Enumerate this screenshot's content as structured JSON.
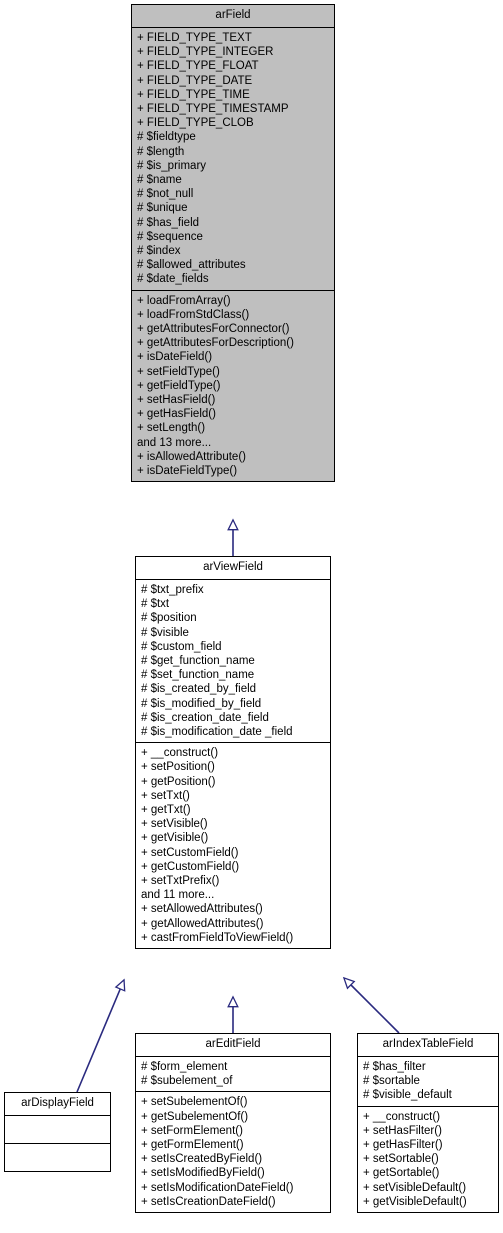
{
  "diagram": {
    "type": "uml-class-inheritance",
    "background_color": "#ffffff",
    "edge_color": "#2a2a7f",
    "base_fill_color": "#bfbfbf",
    "border_color": "#000000"
  },
  "classes": {
    "arField": {
      "name": "arField",
      "attributes": [
        "+ FIELD_TYPE_TEXT",
        "+ FIELD_TYPE_INTEGER",
        "+ FIELD_TYPE_FLOAT",
        "+ FIELD_TYPE_DATE",
        "+ FIELD_TYPE_TIME",
        "+ FIELD_TYPE_TIMESTAMP",
        "+ FIELD_TYPE_CLOB",
        "# $fieldtype",
        "# $length",
        "# $is_primary",
        "# $name",
        "# $not_null",
        "# $unique",
        "# $has_field",
        "# $sequence",
        "# $index",
        "# $allowed_attributes",
        "# $date_fields"
      ],
      "methods": [
        "+ loadFromArray()",
        "+ loadFromStdClass()",
        "+ getAttributesForConnector()",
        "+ getAttributesForDescription()",
        "+ isDateField()",
        "+ setFieldType()",
        "+ getFieldType()",
        "+ setHasField()",
        "+ getHasField()",
        "+ setLength()",
        "and 13 more...",
        "+ isAllowedAttribute()",
        "+ isDateFieldType()"
      ]
    },
    "arViewField": {
      "name": "arViewField",
      "attributes": [
        "# $txt_prefix",
        "# $txt",
        "# $position",
        "# $visible",
        "# $custom_field",
        "# $get_function_name",
        "# $set_function_name",
        "# $is_created_by_field",
        "# $is_modified_by_field",
        "# $is_creation_date_field",
        "# $is_modification_date _field"
      ],
      "methods": [
        "+ __construct()",
        "+ setPosition()",
        "+ getPosition()",
        "+ setTxt()",
        "+ getTxt()",
        "+ setVisible()",
        "+ getVisible()",
        "+ setCustomField()",
        "+ getCustomField()",
        "+ setTxtPrefix()",
        "and 11 more...",
        "+ setAllowedAttributes()",
        "+ getAllowedAttributes()",
        "+ castFromFieldToViewField()"
      ]
    },
    "arEditField": {
      "name": "arEditField",
      "attributes": [
        "# $form_element",
        "# $subelement_of"
      ],
      "methods": [
        "+ setSubelementOf()",
        "+ getSubelementOf()",
        "+ setFormElement()",
        "+ getFormElement()",
        "+ setIsCreatedByField()",
        "+ setIsModifiedByField()",
        "+ setIsModificationDateField()",
        "+ setIsCreationDateField()"
      ]
    },
    "arIndexTableField": {
      "name": "arIndexTableField",
      "attributes": [
        "# $has_filter",
        "# $sortable",
        "# $visible_default"
      ],
      "methods": [
        "+ __construct()",
        "+ setHasFilter()",
        "+ getHasFilter()",
        "+ setSortable()",
        "+ getSortable()",
        "+ setVisibleDefault()",
        "+ getVisibleDefault()"
      ]
    },
    "arDisplayField": {
      "name": "arDisplayField",
      "attributes": [],
      "methods": []
    }
  },
  "relationships": [
    {
      "from": "arViewField",
      "to": "arField",
      "kind": "generalization"
    },
    {
      "from": "arEditField",
      "to": "arViewField",
      "kind": "generalization"
    },
    {
      "from": "arIndexTableField",
      "to": "arViewField",
      "kind": "generalization"
    },
    {
      "from": "arDisplayField",
      "to": "arViewField",
      "kind": "generalization"
    }
  ]
}
